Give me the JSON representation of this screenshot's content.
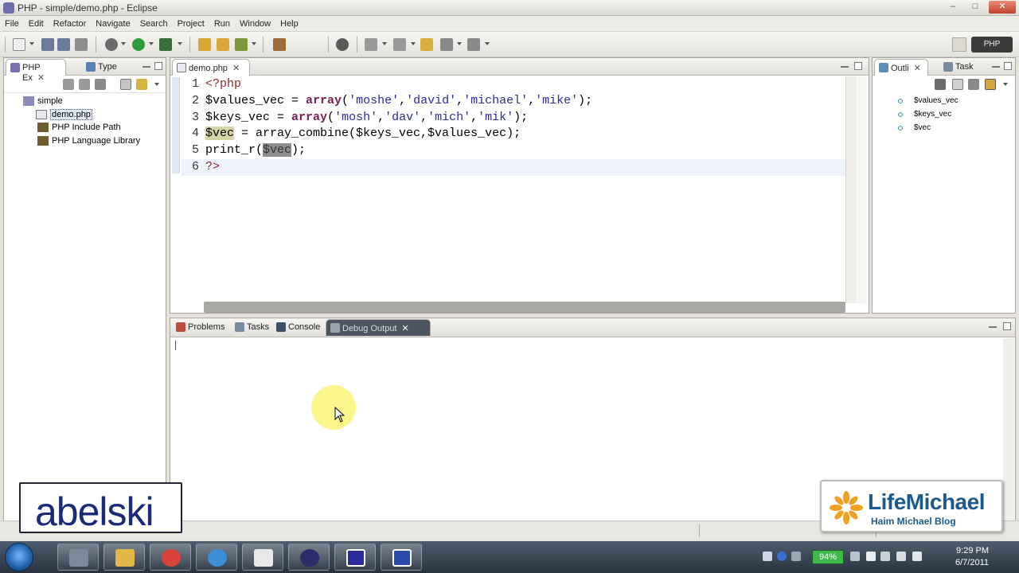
{
  "window": {
    "title": "PHP - simple/demo.php - Eclipse",
    "controls": [
      "–",
      "□",
      "✕"
    ]
  },
  "menu": [
    "File",
    "Edit",
    "Refactor",
    "Navigate",
    "Search",
    "Project",
    "Run",
    "Window",
    "Help"
  ],
  "perspective": {
    "label": "PHP"
  },
  "explorer": {
    "tabs": [
      {
        "label": "PHP Ex",
        "close": "✕"
      },
      {
        "label": "Type"
      }
    ],
    "tree": [
      {
        "label": "simple"
      },
      {
        "label": "demo.php"
      },
      {
        "label": "PHP Include Path"
      },
      {
        "label": "PHP Language Library"
      }
    ]
  },
  "editor": {
    "tab": {
      "label": "demo.php",
      "close": "✕"
    },
    "lines": [
      {
        "n": "1",
        "tokens": [
          {
            "t": "<?php",
            "c": "kw-php"
          }
        ]
      },
      {
        "n": "2",
        "tokens": [
          {
            "t": "$values_vec = ",
            "c": "var"
          },
          {
            "t": "array",
            "c": "kw"
          },
          {
            "t": "(",
            "c": "var"
          },
          {
            "t": "'moshe'",
            "c": "str"
          },
          {
            "t": ",",
            "c": "var"
          },
          {
            "t": "'david'",
            "c": "str"
          },
          {
            "t": ",",
            "c": "var"
          },
          {
            "t": "'michael'",
            "c": "str"
          },
          {
            "t": ",",
            "c": "var"
          },
          {
            "t": "'mike'",
            "c": "str"
          },
          {
            "t": ");",
            "c": "var"
          }
        ]
      },
      {
        "n": "3",
        "tokens": [
          {
            "t": "$keys_vec = ",
            "c": "var"
          },
          {
            "t": "array",
            "c": "kw"
          },
          {
            "t": "(",
            "c": "var"
          },
          {
            "t": "'mosh'",
            "c": "str"
          },
          {
            "t": ",",
            "c": "var"
          },
          {
            "t": "'dav'",
            "c": "str"
          },
          {
            "t": ",",
            "c": "var"
          },
          {
            "t": "'mich'",
            "c": "str"
          },
          {
            "t": ",",
            "c": "var"
          },
          {
            "t": "'mik'",
            "c": "str"
          },
          {
            "t": ");",
            "c": "var"
          }
        ]
      },
      {
        "n": "4",
        "tokens": [
          {
            "t": "$vec",
            "c": "hl-var"
          },
          {
            "t": " = array_combine($keys_vec,$values_vec);",
            "c": "var"
          }
        ]
      },
      {
        "n": "5",
        "tokens": [
          {
            "t": "print_r(",
            "c": "var"
          },
          {
            "t": "$vec",
            "c": "hl-sel"
          },
          {
            "t": ");",
            "c": "var"
          }
        ]
      },
      {
        "n": "6",
        "tokens": [
          {
            "t": "?>",
            "c": "kw-php"
          }
        ]
      }
    ]
  },
  "outline": {
    "tabs": [
      {
        "label": "Outli",
        "close": "✕"
      },
      {
        "label": "Task"
      }
    ],
    "items": [
      {
        "label": "$values_vec"
      },
      {
        "label": "$keys_vec"
      },
      {
        "label": "$vec"
      }
    ]
  },
  "console": {
    "tabs": [
      {
        "label": "Problems"
      },
      {
        "label": "Tasks"
      },
      {
        "label": "Console"
      },
      {
        "label": "Debug Output",
        "close": "✕"
      }
    ]
  },
  "taskbar": {
    "battery": "94%",
    "time": "9:29 PM",
    "date": "6/7/2011"
  },
  "watermarks": {
    "left": "abelski",
    "right_brand": "LifeMichael",
    "right_sub": "Haim Michael Blog"
  }
}
